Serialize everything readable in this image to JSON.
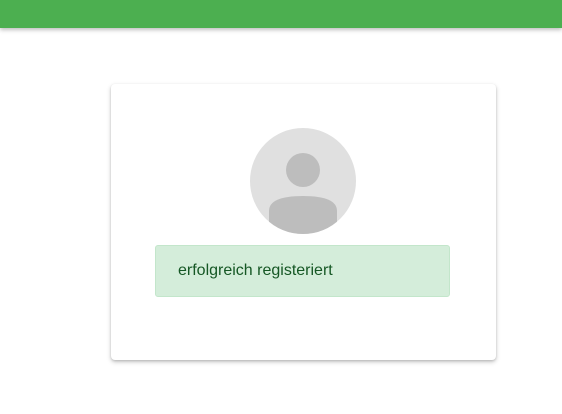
{
  "header": {
    "color": "#4caf50"
  },
  "card": {
    "avatar_icon": "user-avatar-icon",
    "message": "erfolgreich registeriert",
    "message_color": "#155724",
    "message_background": "#d4edda"
  }
}
